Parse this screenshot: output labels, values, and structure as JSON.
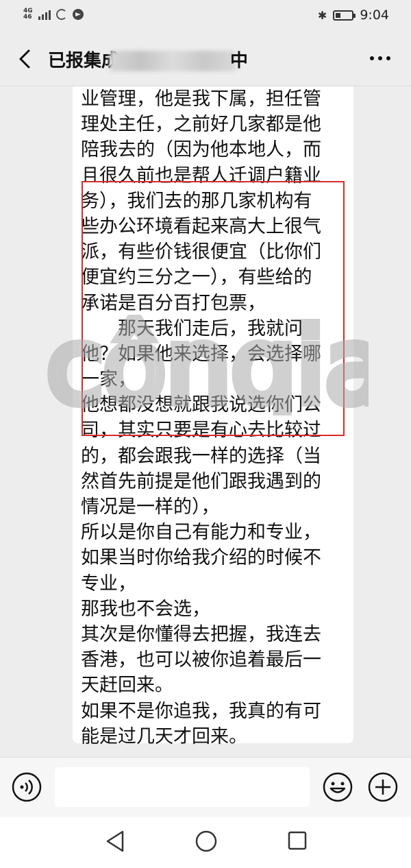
{
  "status_bar": {
    "network": "4G",
    "network_sub": "46",
    "bluetooth_icon": "bluetooth-icon",
    "battery_level": 0.3,
    "time": "9:04"
  },
  "nav": {
    "title_start": "已报集成",
    "title_end": "中",
    "back_icon": "chevron-left-icon",
    "more_icon": "ellipsis-icon"
  },
  "message": {
    "lines": [
      "业管理，他是我下属，担任管",
      "理处主任，之前好几家都是他",
      "陪我去的（因为他本地人，而",
      "且很久前也是帮人迁调户籍业",
      "务），我们去的那几家机构有",
      "些办公环境看起来高大上很气",
      "派，有些价钱很便宜（比你们",
      "便宜约三分之一），有些给的",
      "承诺是百分百打包票，",
      "　　那天我们走后，我就问",
      "他？如果他来选择，会选择哪",
      "一家，",
      "他想都没想就跟我说选你们公",
      "司，其实只要是有心去比较过",
      "的，都会跟我一样的选择（当",
      "然首先前提是他们跟我遇到的",
      "情况是一样的），",
      "所以是你自己有能力和专业，",
      "如果当时你给我介绍的时候不",
      "专业，",
      "那我也不会选，",
      "其次是你懂得去把握，我连去",
      "香港，也可以被你追着最后一",
      "天赶回来。",
      "如果不是你追我，我真的有可",
      "能是过几天才回来。"
    ],
    "highlight_color": "#d62b2b"
  },
  "watermark": {
    "text": "cônqia"
  },
  "input_bar": {
    "voice_icon": "voice-icon",
    "input_value": "",
    "emoji_icon": "emoji-icon",
    "plus_icon": "plus-icon"
  },
  "system_nav": {
    "back": "triangle-back-icon",
    "home": "circle-home-icon",
    "recent": "square-recent-icon"
  }
}
